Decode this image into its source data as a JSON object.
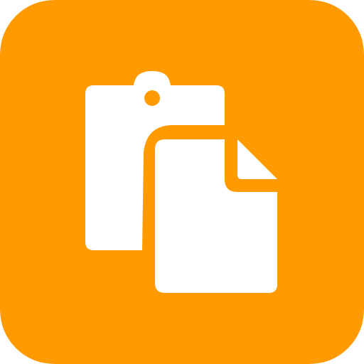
{
  "app_icon": {
    "icon": "paste-clipboard-icon",
    "background_color": "#FF9B00",
    "foreground_color": "#FFFFFF"
  }
}
